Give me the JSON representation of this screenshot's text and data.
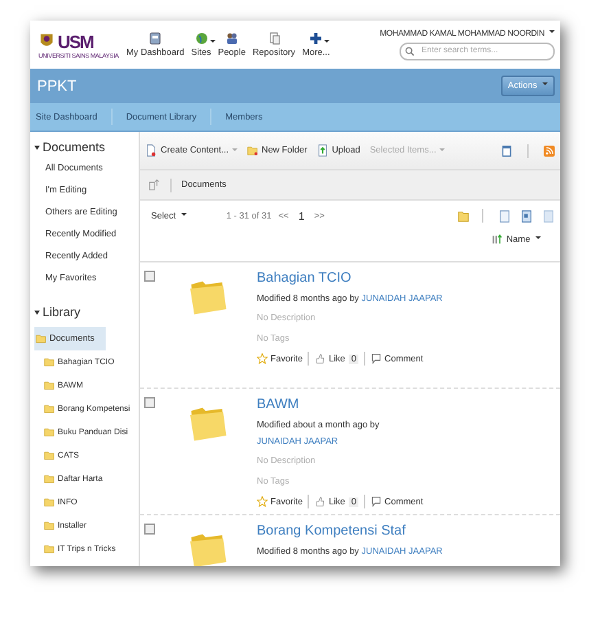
{
  "header": {
    "logo_text": "USM",
    "logo_subtext": "UNIVERSITI SAINS MALAYSIA",
    "nav": [
      {
        "label": "My Dashboard",
        "kind": "dashboard",
        "has_caret": false
      },
      {
        "label": "Sites",
        "kind": "sites",
        "has_caret": true
      },
      {
        "label": "People",
        "kind": "people",
        "has_caret": false
      },
      {
        "label": "Repository",
        "kind": "repository",
        "has_caret": false
      },
      {
        "label": "More...",
        "kind": "more",
        "has_caret": true
      }
    ],
    "user_name": "MOHAMMAD KAMAL MOHAMMAD NOORDIN",
    "search": {
      "placeholder": "Enter search terms..."
    }
  },
  "site": {
    "title": "PPKT",
    "actions": "Actions"
  },
  "subnav": [
    "Site Dashboard",
    "Document Library",
    "Members"
  ],
  "sidebar": {
    "documents": {
      "heading": "Documents",
      "expanded": true,
      "filters": [
        "All Documents",
        "I'm Editing",
        "Others are Editing",
        "Recently Modified",
        "Recently Added",
        "My Favorites"
      ]
    },
    "library": {
      "heading": "Library",
      "expanded": true,
      "tree": [
        {
          "label": "Documents",
          "selected": true,
          "children": [
            {
              "label": "Bahagian TCIO",
              "selected": false
            },
            {
              "label": "BAWM",
              "selected": false
            },
            {
              "label": "Borang Kompetensi",
              "selected": false
            },
            {
              "label": "Buku Panduan Disi",
              "selected": false
            },
            {
              "label": "CATS",
              "selected": false
            },
            {
              "label": "Daftar Harta",
              "selected": false
            },
            {
              "label": "INFO",
              "selected": false
            },
            {
              "label": "Installer",
              "selected": false
            },
            {
              "label": "IT Trips n Tricks",
              "selected": false
            }
          ]
        }
      ]
    }
  },
  "toolbar": {
    "buttons": [
      {
        "label": "Create Content...",
        "kind": "create",
        "has_caret": true,
        "disabled": false
      },
      {
        "label": "New Folder",
        "kind": "folder",
        "has_caret": false,
        "disabled": false
      },
      {
        "label": "Upload",
        "kind": "upload",
        "has_caret": false,
        "disabled": false
      },
      {
        "label": "Selected Items...",
        "kind": "plain",
        "has_caret": true,
        "disabled": true
      }
    ]
  },
  "breadcrumb": "Documents",
  "pager": {
    "select": "Select",
    "range": "1 - 31 of 31",
    "first": "<<",
    "page": "1",
    "last": ">>",
    "sort": "Name"
  },
  "items": [
    {
      "title": "Bahagian TCIO",
      "checked": false,
      "modified": "Modified 8 months ago by",
      "author": "JUNAIDAH JAAPAR",
      "description": "No Description",
      "tags": "No Tags",
      "favorite": "Favorite",
      "like": "Like",
      "like_count": "0",
      "comment": "Comment"
    },
    {
      "title": "BAWM",
      "checked": false,
      "modified": "Modified about a month ago by",
      "author": "JUNAIDAH JAAPAR",
      "description": "No Description",
      "tags": "No Tags",
      "favorite": "Favorite",
      "like": "Like",
      "like_count": "0",
      "comment": "Comment"
    },
    {
      "title": "Borang Kompetensi Staf",
      "checked": false,
      "modified": "Modified 8 months ago by",
      "author": "JUNAIDAH JAAPAR"
    }
  ]
}
